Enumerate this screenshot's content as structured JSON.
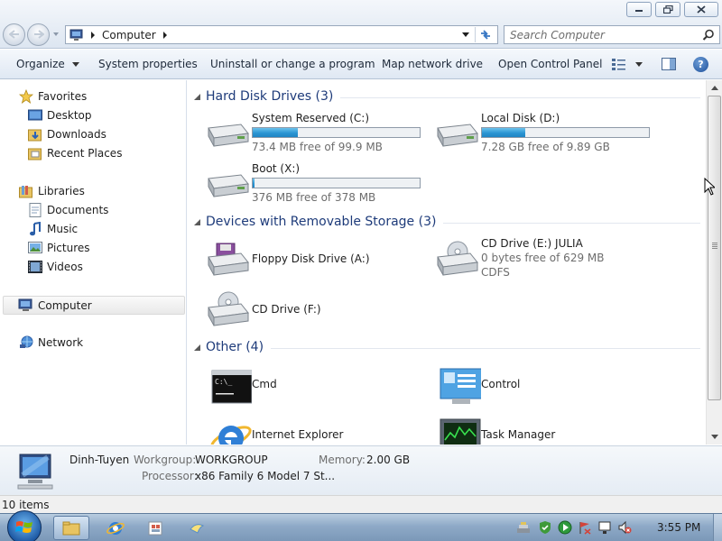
{
  "window": {
    "minimize_icon": "minimize-icon",
    "maximize_icon": "restore-icon",
    "close_icon": "close-icon"
  },
  "address_bar": {
    "location": "Computer"
  },
  "search": {
    "placeholder": "Search Computer"
  },
  "command_bar": {
    "organize": "Organize",
    "system_properties": "System properties",
    "uninstall": "Uninstall or change a program",
    "map_drive": "Map network drive",
    "control_panel": "Open Control Panel",
    "help": "?"
  },
  "navigation": {
    "favorites": "Favorites",
    "desktop": "Desktop",
    "downloads": "Downloads",
    "recent_places": "Recent Places",
    "libraries": "Libraries",
    "documents": "Documents",
    "music": "Music",
    "pictures": "Pictures",
    "videos": "Videos",
    "computer": "Computer",
    "network": "Network"
  },
  "groups": {
    "hard_disks": {
      "title": "Hard Disk Drives (3)",
      "items": [
        {
          "name": "System Reserved (C:)",
          "free": "73.4 MB free of 99.9 MB",
          "used_fraction": 0.27
        },
        {
          "name": "Local Disk (D:)",
          "free": "7.28 GB free of 9.89 GB",
          "used_fraction": 0.26
        },
        {
          "name": "Boot (X:)",
          "free": "376 MB free of 378 MB",
          "used_fraction": 0.01
        }
      ]
    },
    "removable": {
      "title": "Devices with Removable Storage (3)",
      "items": [
        {
          "name": "Floppy Disk Drive (A:)"
        },
        {
          "name": "CD Drive (E:) JULIA",
          "free": "0 bytes free of 629 MB",
          "fs": "CDFS"
        },
        {
          "name": "CD Drive (F:)"
        }
      ]
    },
    "other": {
      "title": "Other (4)",
      "items": [
        {
          "name": "Cmd"
        },
        {
          "name": "Control"
        },
        {
          "name": "Internet Explorer"
        },
        {
          "name": "Task Manager"
        }
      ]
    }
  },
  "details": {
    "machine": "Dinh-Tuyen",
    "workgroup_label": "Workgroup:",
    "workgroup": "WORKGROUP",
    "memory_label": "Memory:",
    "memory": "2.00 GB",
    "processor_label": "Processor:",
    "processor": "x86 Family 6 Model 7 St..."
  },
  "status": {
    "items": "10 items"
  },
  "taskbar": {
    "time": "3:55 PM"
  },
  "colors": {
    "accent_group_title": "#1e3b7a",
    "bar_fill": "#2b95d3"
  }
}
